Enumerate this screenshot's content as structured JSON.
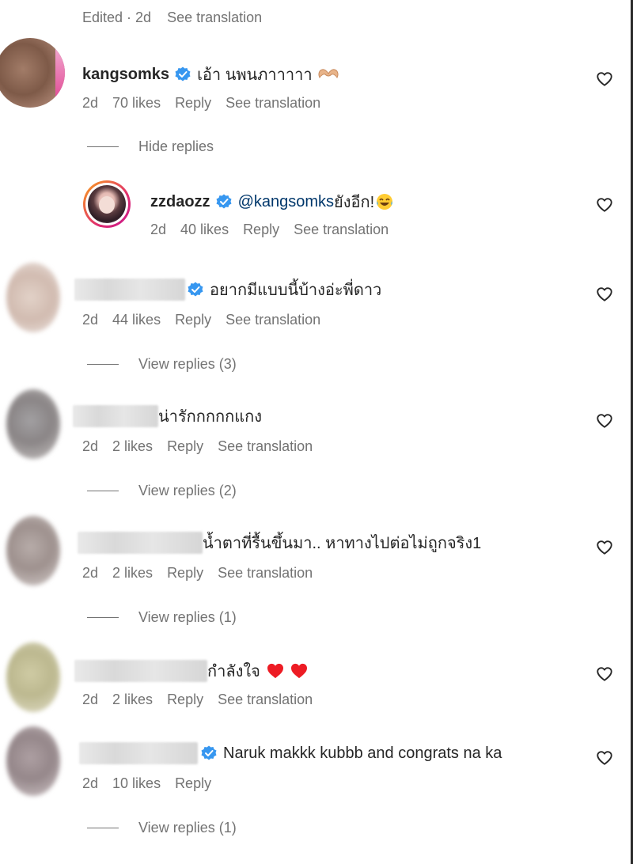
{
  "top": {
    "edited": "Edited",
    "dot": " · ",
    "age": "2d",
    "see_translation": "See translation"
  },
  "labels": {
    "reply": "Reply",
    "see_translation": "See translation",
    "hide_replies": "Hide replies"
  },
  "comments": [
    {
      "username": "kangsomks",
      "verified": true,
      "text": "เอ้า นพนภาาาาา",
      "age": "2d",
      "likes": "70 likes",
      "has_translation": true,
      "replies_toggle": "Hide replies"
    },
    {
      "username": "zzdaozz",
      "verified": true,
      "mention": "@kangsomks",
      "text": " ยังอีก!",
      "age": "2d",
      "likes": "40 likes",
      "has_translation": true
    },
    {
      "username": "",
      "verified": true,
      "text": "อยากมีแบบนี้บ้างอ่ะพี่ดาว",
      "age": "2d",
      "likes": "44 likes",
      "has_translation": true,
      "replies_toggle": "View replies (3)"
    },
    {
      "username": "",
      "verified": false,
      "text": "น่ารักกกกกแกง",
      "age": "2d",
      "likes": "2 likes",
      "has_translation": true,
      "replies_toggle": "View replies (2)"
    },
    {
      "username": "",
      "verified": false,
      "text": "น้ำตาที่รื้นขึ้นมา.. หาทางไปต่อไม่ถูกจริง1",
      "age": "2d",
      "likes": "2 likes",
      "has_translation": true,
      "replies_toggle": "View replies (1)"
    },
    {
      "username": "",
      "verified": false,
      "text": "กำลังใจ",
      "age": "2d",
      "likes": "2 likes",
      "has_translation": true
    },
    {
      "username": "",
      "verified": true,
      "text": "Naruk makkk kubbb and congrats na ka",
      "age": "2d",
      "likes": "10 likes",
      "has_translation": false,
      "replies_toggle": "View replies (1)"
    }
  ],
  "colors": {
    "verified_blue": "#3797f0",
    "meta_gray": "#737373",
    "mention_blue": "#00376b",
    "heart_red": "#ed1c24",
    "story_ring_start": "#f9a21b",
    "story_ring_end": "#c7158f"
  },
  "icons": {
    "verified": "verified-badge-icon",
    "like": "heart-outline-icon",
    "heart_hands": "heart-hands-emoji",
    "laugh": "laughing-emoji",
    "red_heart": "red-heart-emoji"
  }
}
